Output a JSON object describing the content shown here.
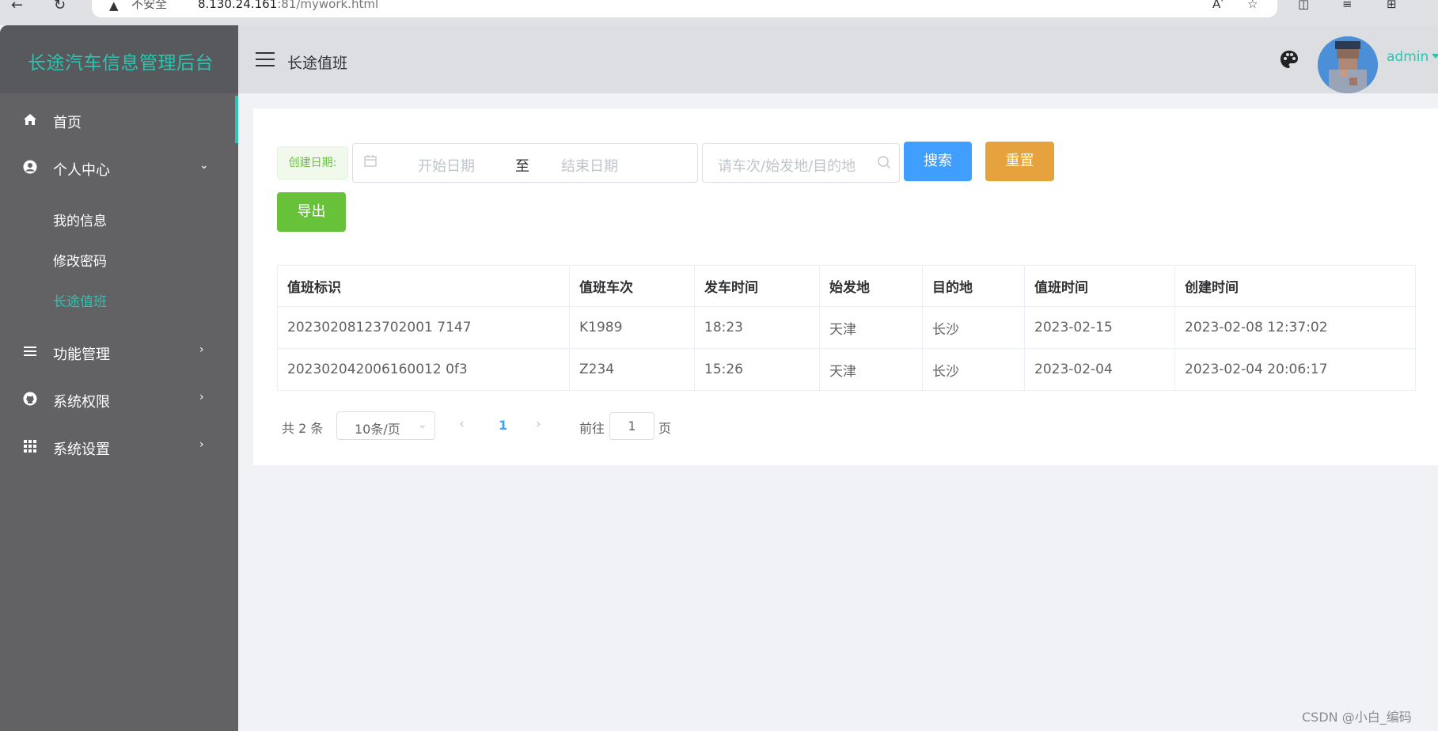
{
  "browser": {
    "security_label": "不安全",
    "url_host": "8.130.24.161",
    "url_rest": ":81/mywork.html",
    "read_aloud": "Aʹ"
  },
  "sidebar": {
    "brand": "长途汽车信息管理后台",
    "items": [
      {
        "label": "首页",
        "icon": "home-icon"
      },
      {
        "label": "个人中心",
        "icon": "user-circle-icon"
      },
      {
        "label": "功能管理",
        "icon": "list-icon"
      },
      {
        "label": "系统权限",
        "icon": "github-icon"
      },
      {
        "label": "系统设置",
        "icon": "grid-icon"
      }
    ],
    "sub_items": [
      {
        "label": "我的信息"
      },
      {
        "label": "修改密码"
      },
      {
        "label": "长途值班"
      }
    ]
  },
  "header": {
    "title": "长途值班",
    "username": "admin"
  },
  "filters": {
    "date_label": "创建日期:",
    "start_placeholder": "开始日期",
    "separator": "至",
    "end_placeholder": "结束日期",
    "search_placeholder": "请车次/始发地/目的地",
    "search_button": "搜索",
    "reset_button": "重置",
    "export_button": "导出"
  },
  "table": {
    "columns": [
      "值班标识",
      "值班车次",
      "发车时间",
      "始发地",
      "目的地",
      "值班时间",
      "创建时间"
    ],
    "rows": [
      [
        "20230208123702001 7147",
        "K1989",
        "18:23",
        "天津",
        "长沙",
        "2023-02-15",
        "2023-02-08 12:37:02"
      ],
      [
        "202302042006160012 0f3",
        "Z234",
        "15:26",
        "天津",
        "长沙",
        "2023-02-04",
        "2023-02-04 20:06:17"
      ]
    ]
  },
  "pagination": {
    "total": "共 2 条",
    "page_size": "10条/页",
    "current_page": "1",
    "goto_label": "前往",
    "goto_value": "1",
    "page_suffix": "页"
  },
  "watermark": "CSDN @小白_编码",
  "colors": {
    "accent": "#2ec2b0",
    "sidebar": "#626265",
    "primary": "#409eff",
    "warning": "#e6a23c",
    "success": "#67c23a"
  }
}
